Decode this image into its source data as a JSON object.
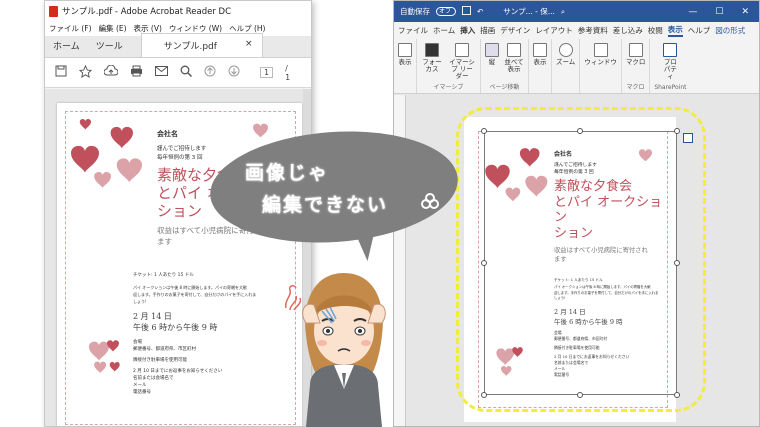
{
  "acrobat": {
    "title": "サンプル.pdf - Adobe Acrobat Reader DC",
    "menu": [
      "ファイル (F)",
      "編集 (E)",
      "表示 (V)",
      "ウィンドウ (W)",
      "ヘルプ (H)"
    ],
    "tabs": {
      "home": "ホーム",
      "tools": "ツール",
      "doc": "サンプル.pdf",
      "close": "×"
    },
    "page_current": "1",
    "page_total": "/ 1"
  },
  "flyer": {
    "company": "会社名",
    "invite_1": "謹んでご招待します",
    "invite_2": "毎年恒例の第 3 回",
    "title_1": "素敵な夕食会",
    "title_2": "とパイ オークー",
    "title_3": "ション",
    "sub_1": "収益はすべて小児病院に寄付され",
    "sub_2": "ます",
    "ticket": "チケット: 1 人あたり 15 ドル",
    "desc_1": "パイ オークションは午後 8 時に開始します。パイの寄贈を大歓",
    "desc_2": "迎します。手作りのお菓子を寄付して、自分だけのパイを手に入れま",
    "desc_3": "しょう!",
    "date": "2 月 14 日",
    "time": "午後 6 時から午後 9 時",
    "place": "会場",
    "addr": "郵便番号、都道府県、市区町村",
    "parking": "隣接付き駐車場を使用可能",
    "rsvp_1": "2 月 10 日までにお返事をお知らせください",
    "rsvp_2": "名前または会場名で",
    "mail": "メール",
    "phone": "電話番号"
  },
  "flyer_word": {
    "title_2": "とパイ オークション"
  },
  "word": {
    "autosave": "自動保存",
    "toggle": "オフ",
    "title": "サンプ... - 保...",
    "win_min": "—",
    "win_max": "☐",
    "win_close": "✕",
    "tabs": [
      "ファイル",
      "ホーム",
      "挿入",
      "描画",
      "デザイン",
      "レイアウト",
      "参考資料",
      "差し込み",
      "校閲",
      "表示",
      "ヘルプ",
      "図の形式"
    ],
    "active_tab": "表示",
    "groups": [
      {
        "buttons": [
          "表示"
        ],
        "label": ""
      },
      {
        "buttons": [
          "フォーカス",
          "イマーシブ リーダー"
        ],
        "label": "イマーシブ"
      },
      {
        "buttons": [
          "縦",
          "並べて 表示"
        ],
        "label": "ページ移動"
      },
      {
        "buttons": [
          "表示"
        ],
        "label": ""
      },
      {
        "buttons": [
          "ズーム"
        ],
        "label": ""
      },
      {
        "buttons": [
          "ウィンドウ"
        ],
        "label": ""
      },
      {
        "buttons": [
          "マクロ"
        ],
        "label": "マクロ"
      },
      {
        "buttons": [
          "プロ パティ"
        ],
        "label": "SharePoint"
      }
    ]
  },
  "bubble": {
    "line1": "画像じゃ",
    "line2": "編集できない"
  },
  "colors": {
    "accent": "#2b579a",
    "title": "#c0505b",
    "heart_dark": "#c0505b",
    "heart_light": "#dba3a8",
    "highlight": "#f2ec3a"
  }
}
